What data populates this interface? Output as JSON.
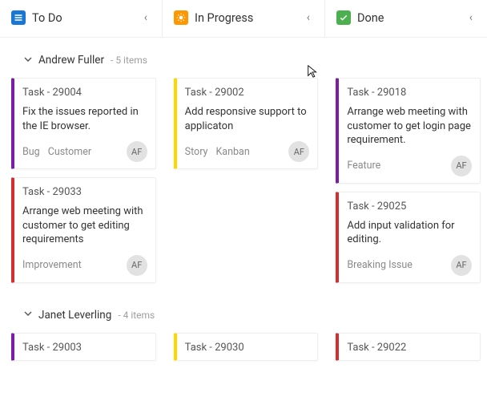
{
  "columns": [
    {
      "id": "todo",
      "title": "To Do"
    },
    {
      "id": "progress",
      "title": "In Progress"
    },
    {
      "id": "done",
      "title": "Done"
    }
  ],
  "swimlanes": [
    {
      "name": "Andrew Fuller",
      "count_label": "- 5 items",
      "cells": {
        "todo": [
          {
            "color": "purple",
            "title": "Task - 29004",
            "desc": "Fix the issues reported in the IE browser.",
            "tags": [
              "Bug",
              "Customer"
            ],
            "avatar": "AF"
          },
          {
            "color": "red",
            "title": "Task - 29033",
            "desc": "Arrange web meeting with customer to get editing requirements",
            "tags": [
              "Improvement"
            ],
            "avatar": "AF"
          }
        ],
        "progress": [
          {
            "color": "yellow",
            "title": "Task - 29002",
            "desc": "Add responsive support to applicaton",
            "tags": [
              "Story",
              "Kanban"
            ],
            "avatar": "AF"
          }
        ],
        "done": [
          {
            "color": "purple",
            "title": "Task - 29018",
            "desc": "Arrange web meeting with customer to get login page requirement.",
            "tags": [
              "Feature"
            ],
            "avatar": "AF"
          },
          {
            "color": "red",
            "title": "Task - 29025",
            "desc": "Add input validation for editing.",
            "tags": [
              "Breaking Issue"
            ],
            "avatar": "AF"
          }
        ]
      }
    },
    {
      "name": "Janet Leverling",
      "count_label": "- 4 items",
      "cells": {
        "todo": [
          {
            "color": "purple",
            "title": "Task - 29003",
            "desc": "",
            "tags": [],
            "avatar": ""
          }
        ],
        "progress": [
          {
            "color": "yellow",
            "title": "Task - 29030",
            "desc": "",
            "tags": [],
            "avatar": ""
          }
        ],
        "done": [
          {
            "color": "red",
            "title": "Task - 29022",
            "desc": "",
            "tags": [],
            "avatar": ""
          }
        ]
      }
    }
  ]
}
